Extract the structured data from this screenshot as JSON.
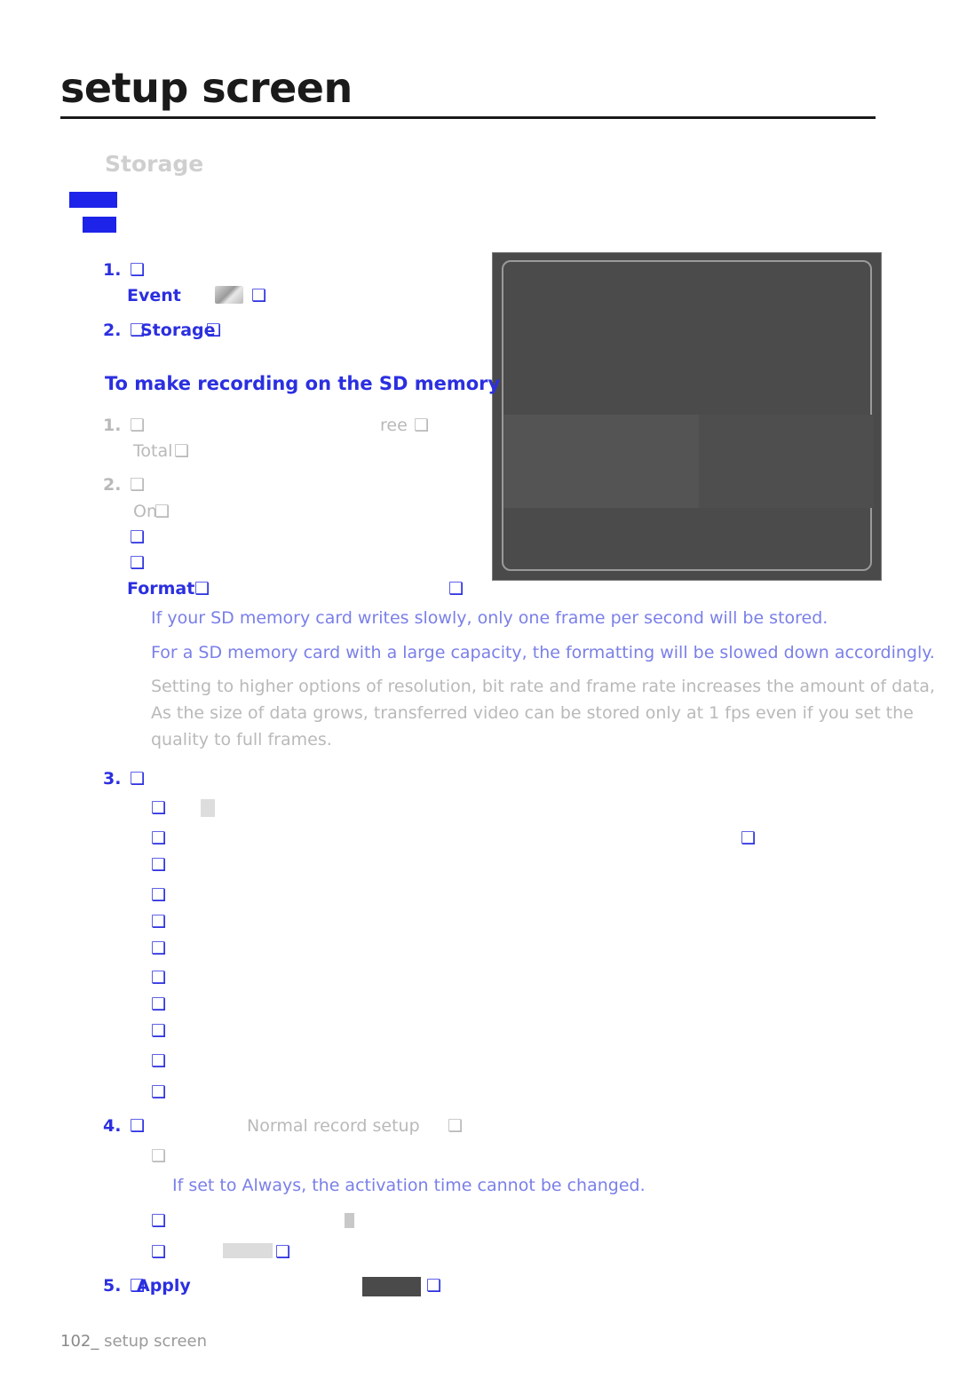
{
  "header": {
    "title": "setup screen"
  },
  "section": {
    "title": "Storage"
  },
  "steps_top": [
    {
      "num": "1.",
      "glyph": "❑",
      "label": "Event",
      "trailing_glyph": "❑"
    },
    {
      "num": "2.",
      "glyph": "❑",
      "label": "Storage",
      "trailing_glyph": "❑"
    }
  ],
  "sub_heading": "To make recording on the SD memory",
  "sd_steps": [
    {
      "num": "1.",
      "glyph": "❑",
      "right_text": "ree",
      "right_glyph": "❑",
      "sub_label": "Total",
      "sub_glyph": "❑"
    },
    {
      "num": "2.",
      "glyph": "❑",
      "sub_label": "On",
      "sub_glyph": "❑"
    }
  ],
  "bullet_glyphs": [
    "❑",
    "❑"
  ],
  "format_line": {
    "label": "Format",
    "glyph": "❑",
    "right_glyph": "❑"
  },
  "notes": [
    {
      "text": "If your SD memory card writes slowly, only one frame per second will be stored.",
      "color": "blue"
    },
    {
      "text": "For a SD memory card with a large capacity, the formatting will be slowed down accordingly.",
      "color": "blue"
    },
    {
      "text": "Setting to higher options of resolution, bit rate and frame rate increases the amount of data,",
      "color": "grey"
    },
    {
      "text": "As the size of data grows, transferred video can be stored only at 1 fps even if you set the",
      "color": "grey"
    },
    {
      "text": "quality to full frames.",
      "color": "grey"
    }
  ],
  "step3": {
    "num": "3.",
    "glyph": "❑",
    "rows": [
      {
        "glyph": "❑",
        "extra": ""
      },
      {
        "glyph": "❑",
        "right_glyph": "❑"
      },
      {
        "glyph": "❑"
      },
      {
        "glyph": "❑"
      },
      {
        "glyph": "❑"
      },
      {
        "glyph": "❑"
      },
      {
        "glyph": "❑"
      },
      {
        "glyph": "❑"
      },
      {
        "glyph": "❑"
      },
      {
        "glyph": "❑"
      },
      {
        "glyph": "❑"
      }
    ]
  },
  "step4": {
    "num": "4.",
    "glyph": "❑",
    "label": "Normal record setup",
    "trailing_glyph": "❑",
    "sub_glyph": "❑",
    "note": "If set to Always, the activation time cannot be changed.",
    "rows": [
      {
        "glyph": "❑"
      },
      {
        "glyph": "❑",
        "trailing_glyph": "❑"
      }
    ]
  },
  "step5": {
    "num": "5.",
    "glyph": "❑",
    "label": "Apply",
    "trailing_glyph": "❑"
  },
  "footer": {
    "page": "102_",
    "text": "setup screen"
  },
  "colors": {
    "accent_blue": "#2b2fe0",
    "note_blue": "#7a7fe8",
    "grey_text": "#b9b9b9",
    "heading": "#1a1a1a"
  }
}
